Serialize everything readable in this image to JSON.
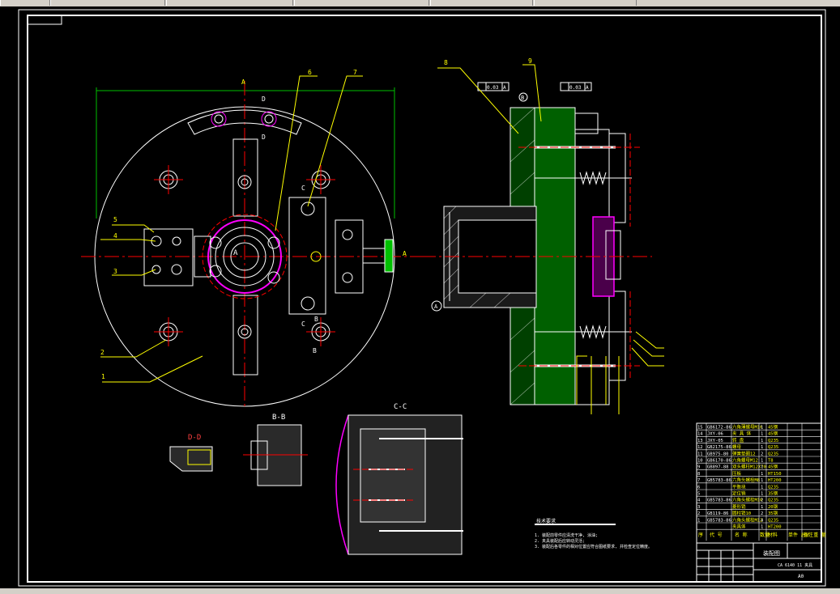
{
  "colors": {
    "background": "#000000",
    "outline": "#ffffff",
    "leader": "#ffff00",
    "centerline": "#ff0000",
    "hatch_green": "#00a000",
    "magenta": "#ff00ff",
    "dimension": "#00c000"
  },
  "labels": {
    "section_aa_top": "A",
    "section_aa_side": "A",
    "center_mark": "A",
    "datum_b": "B",
    "section_d_top": "D",
    "section_d_bottom": "D",
    "section_c_top": "C",
    "section_c_bottom": "C",
    "section_b_top": "B",
    "section_b_bottom": "B",
    "view_dd": "D-D",
    "view_bb": "B-B",
    "view_cc": "C-C",
    "datum_circle": "A"
  },
  "leaders": {
    "n1": "1",
    "n2": "2",
    "n3": "3",
    "n4": "4",
    "n5": "5",
    "n6": "6",
    "n7": "7",
    "n8": "8",
    "n9": "9"
  },
  "tolerances": {
    "perp": "0.03",
    "perp_ref": "A",
    "circ": "0.03",
    "circ_ref": "A"
  },
  "bom": {
    "rows": [
      {
        "no": "15",
        "code": "GB6172-86",
        "name": "六角薄螺母M16",
        "qty": "1",
        "mat": "45钢"
      },
      {
        "no": "14",
        "code": "JXY-06",
        "name": "夹 具 体",
        "qty": "1",
        "mat": "45钢"
      },
      {
        "no": "13",
        "code": "JXY-05",
        "name": "转 盘",
        "qty": "1",
        "mat": "Q235"
      },
      {
        "no": "12",
        "code": "GB2175-86",
        "name": "螺母",
        "qty": "1",
        "mat": "Q235"
      },
      {
        "no": "11",
        "code": "GB975-80",
        "name": "弹簧垫圈12",
        "qty": "2",
        "mat": "Q235"
      },
      {
        "no": "10",
        "code": "GB6170-86",
        "name": "六角螺母M12",
        "qty": "1",
        "mat": "T8"
      },
      {
        "no": "9",
        "code": "GB897-88",
        "name": "双头螺柱M12X70",
        "qty": "1",
        "mat": "45钢"
      },
      {
        "no": "8",
        "code": "",
        "name": "压板",
        "qty": "1",
        "mat": "HT150"
      },
      {
        "no": "7",
        "code": "GB5783-86",
        "name": "六角头螺栓M8",
        "qty": "1",
        "mat": "HT200"
      },
      {
        "no": "6",
        "code": "",
        "name": "平衡块",
        "qty": "1",
        "mat": "Q235"
      },
      {
        "no": "5",
        "code": "",
        "name": "定位销",
        "qty": "1",
        "mat": "35钢"
      },
      {
        "no": "4",
        "code": "GB5783-86",
        "name": "六角头螺栓M10",
        "qty": "2",
        "mat": "Q235"
      },
      {
        "no": "3",
        "code": "",
        "name": "菱形销",
        "qty": "1",
        "mat": "20钢"
      },
      {
        "no": "2",
        "code": "GB119-86",
        "name": "圆柱销10",
        "qty": "2",
        "mat": "35钢"
      },
      {
        "no": "1",
        "code": "GB5783-86",
        "name": "六角头螺栓M12",
        "qty": "4",
        "mat": "Q235"
      },
      {
        "no": "",
        "code": "",
        "name": "夹具体",
        "qty": "1",
        "mat": "HT200"
      }
    ],
    "header": {
      "no": "序",
      "code": "代 号",
      "name": "名 称",
      "qty": "数量",
      "mat": "材料",
      "extra": "单件 总计 重 量",
      "remark": "备注"
    }
  },
  "titleblock": {
    "drawing_name": "装配图",
    "subtitle": "CA 6140 11 夹具",
    "size": "A0"
  },
  "notes": {
    "heading": "技术要求",
    "line1": "1. 装配前零件应清洗干净, 涂油;",
    "line2": "2. 夹具装配后应转动灵活;",
    "line3": "3. 装配后各零件的相对位置应符合图纸要求, 并检查定位精度。"
  }
}
